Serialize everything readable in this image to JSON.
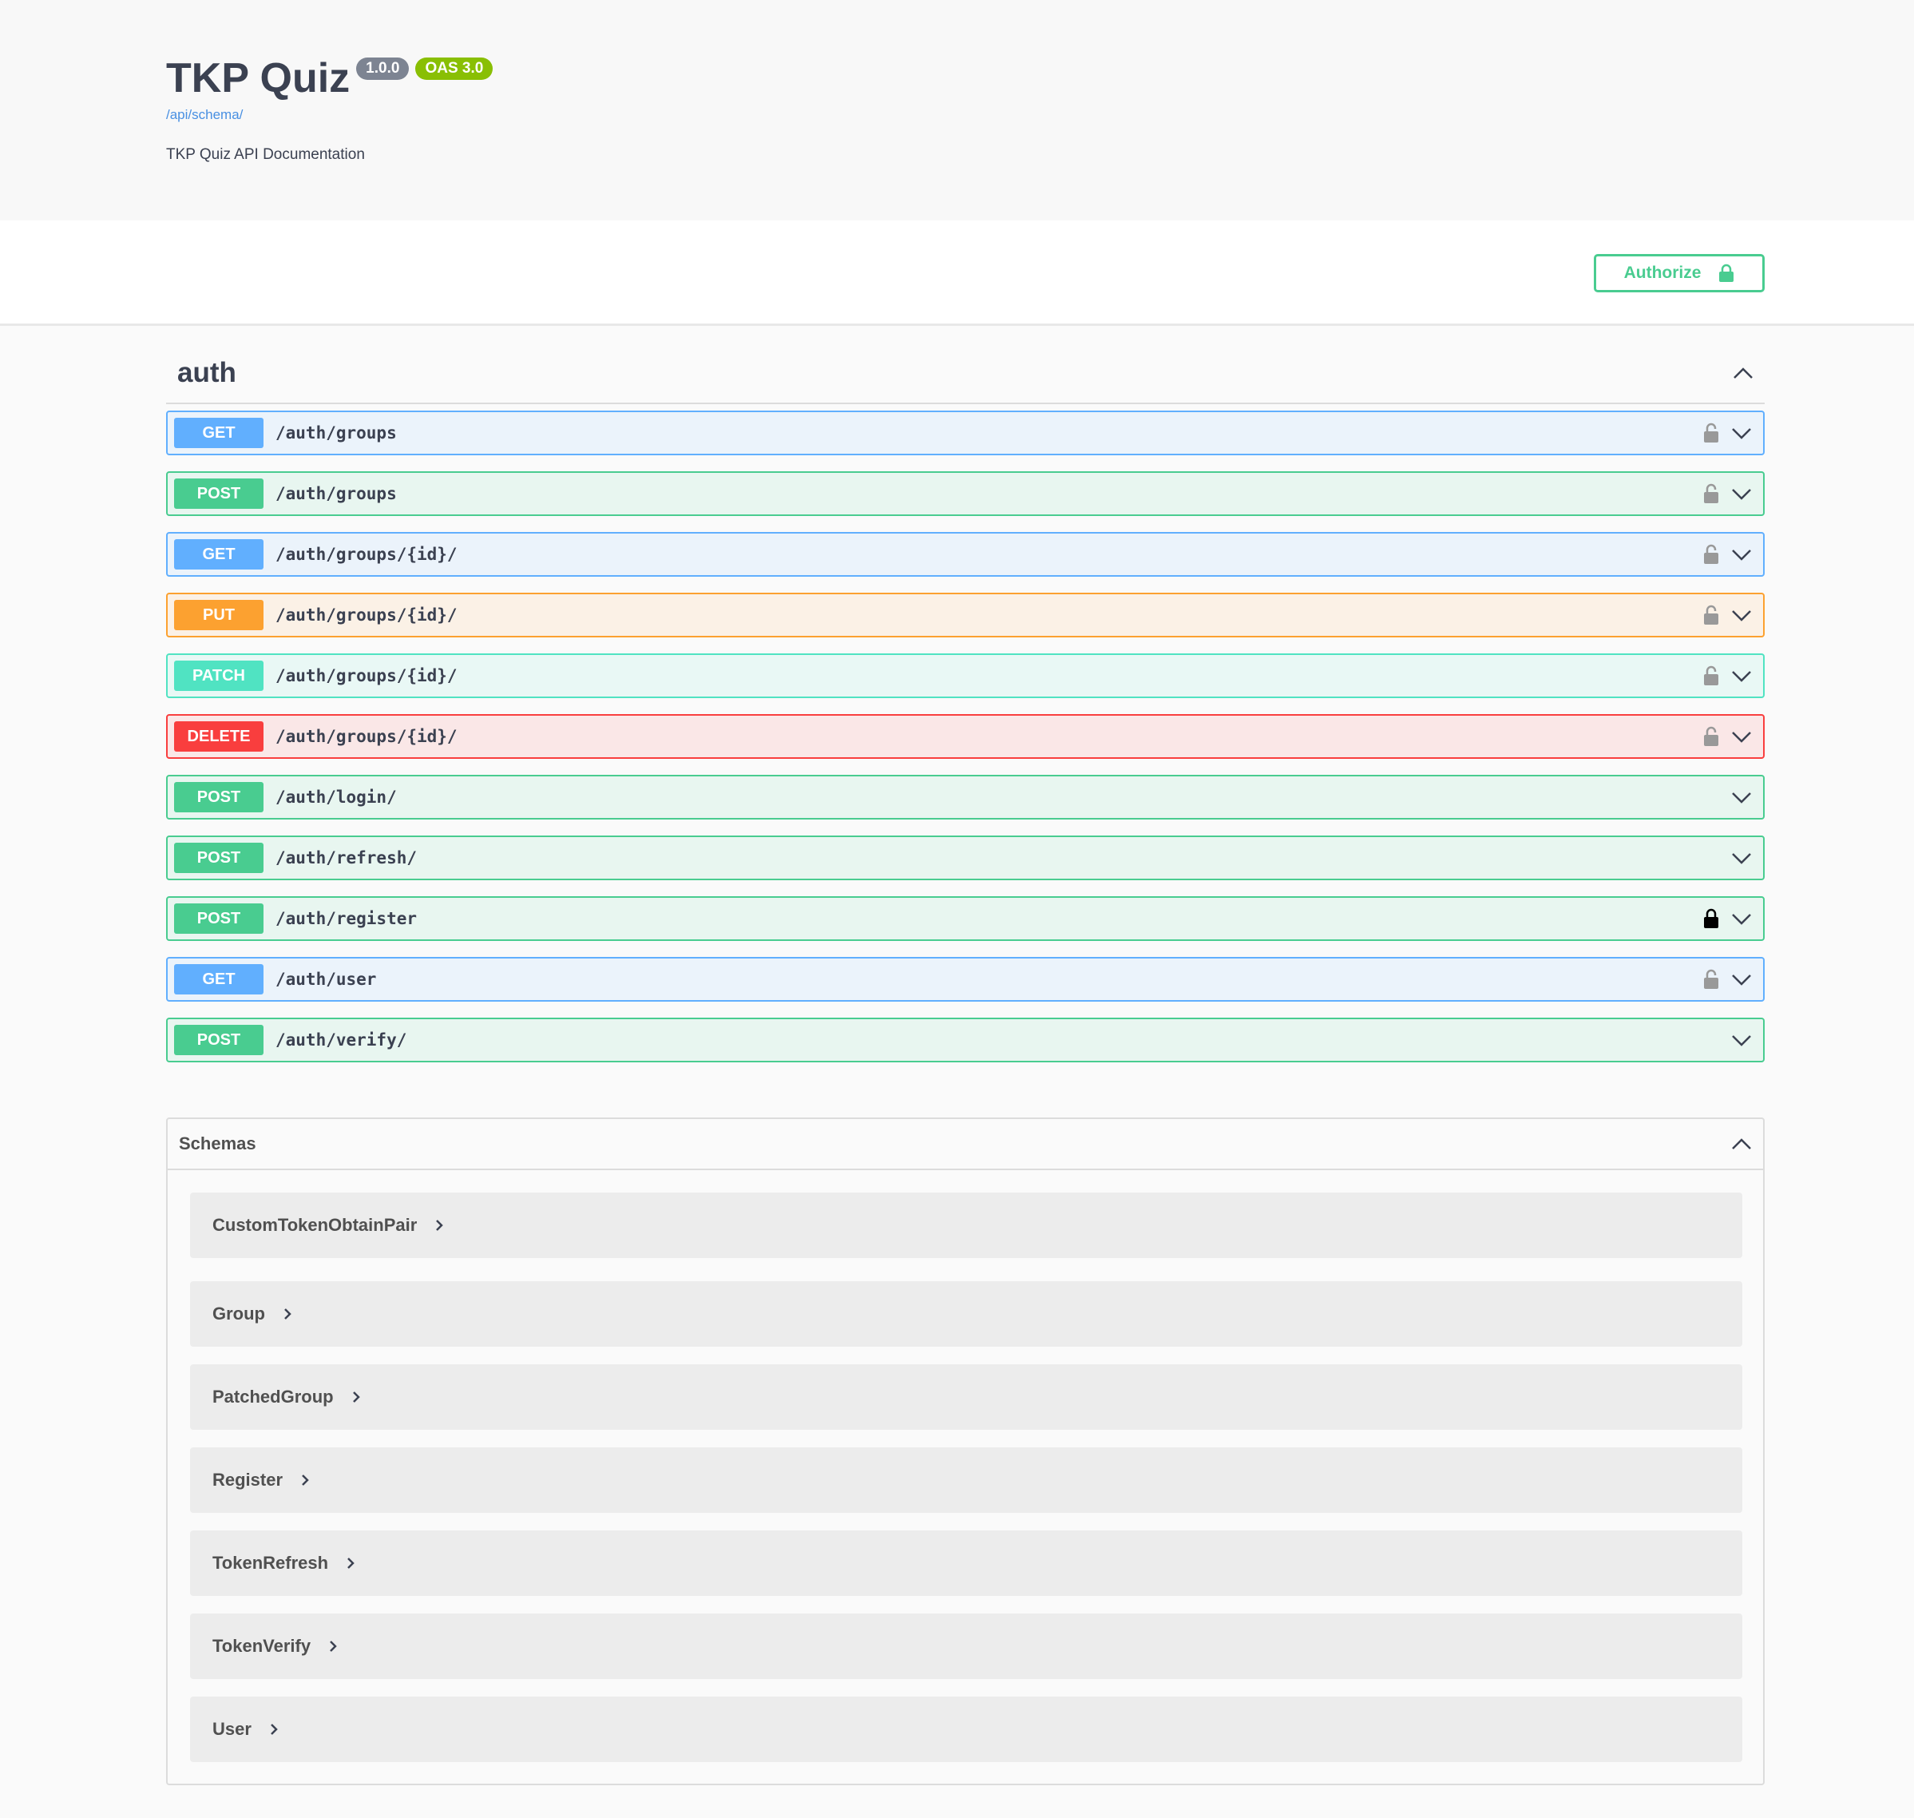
{
  "info": {
    "title": "TKP Quiz",
    "version": "1.0.0",
    "oas": "OAS 3.0",
    "schema_url": "/api/schema/",
    "description": "TKP Quiz API Documentation"
  },
  "auth_button": {
    "label": "Authorize"
  },
  "tag": {
    "name": "auth"
  },
  "operations": [
    {
      "method": "GET",
      "path": "/auth/groups",
      "lock": "unlocked"
    },
    {
      "method": "POST",
      "path": "/auth/groups",
      "lock": "unlocked"
    },
    {
      "method": "GET",
      "path": "/auth/groups/{id}/",
      "lock": "unlocked"
    },
    {
      "method": "PUT",
      "path": "/auth/groups/{id}/",
      "lock": "unlocked"
    },
    {
      "method": "PATCH",
      "path": "/auth/groups/{id}/",
      "lock": "unlocked"
    },
    {
      "method": "DELETE",
      "path": "/auth/groups/{id}/",
      "lock": "unlocked"
    },
    {
      "method": "POST",
      "path": "/auth/login/",
      "lock": "none"
    },
    {
      "method": "POST",
      "path": "/auth/refresh/",
      "lock": "none"
    },
    {
      "method": "POST",
      "path": "/auth/register",
      "lock": "locked"
    },
    {
      "method": "GET",
      "path": "/auth/user",
      "lock": "unlocked"
    },
    {
      "method": "POST",
      "path": "/auth/verify/",
      "lock": "none"
    }
  ],
  "schemas": {
    "title": "Schemas",
    "items": [
      "CustomTokenObtainPair",
      "Group",
      "PatchedGroup",
      "Register",
      "TokenRefresh",
      "TokenVerify",
      "User"
    ]
  },
  "colors": {
    "get": "#61affe",
    "post": "#49cc90",
    "put": "#fca130",
    "patch": "#50e3c2",
    "delete": "#f93e3e",
    "oas_badge": "#89bf04",
    "version_badge": "#7d8492"
  }
}
